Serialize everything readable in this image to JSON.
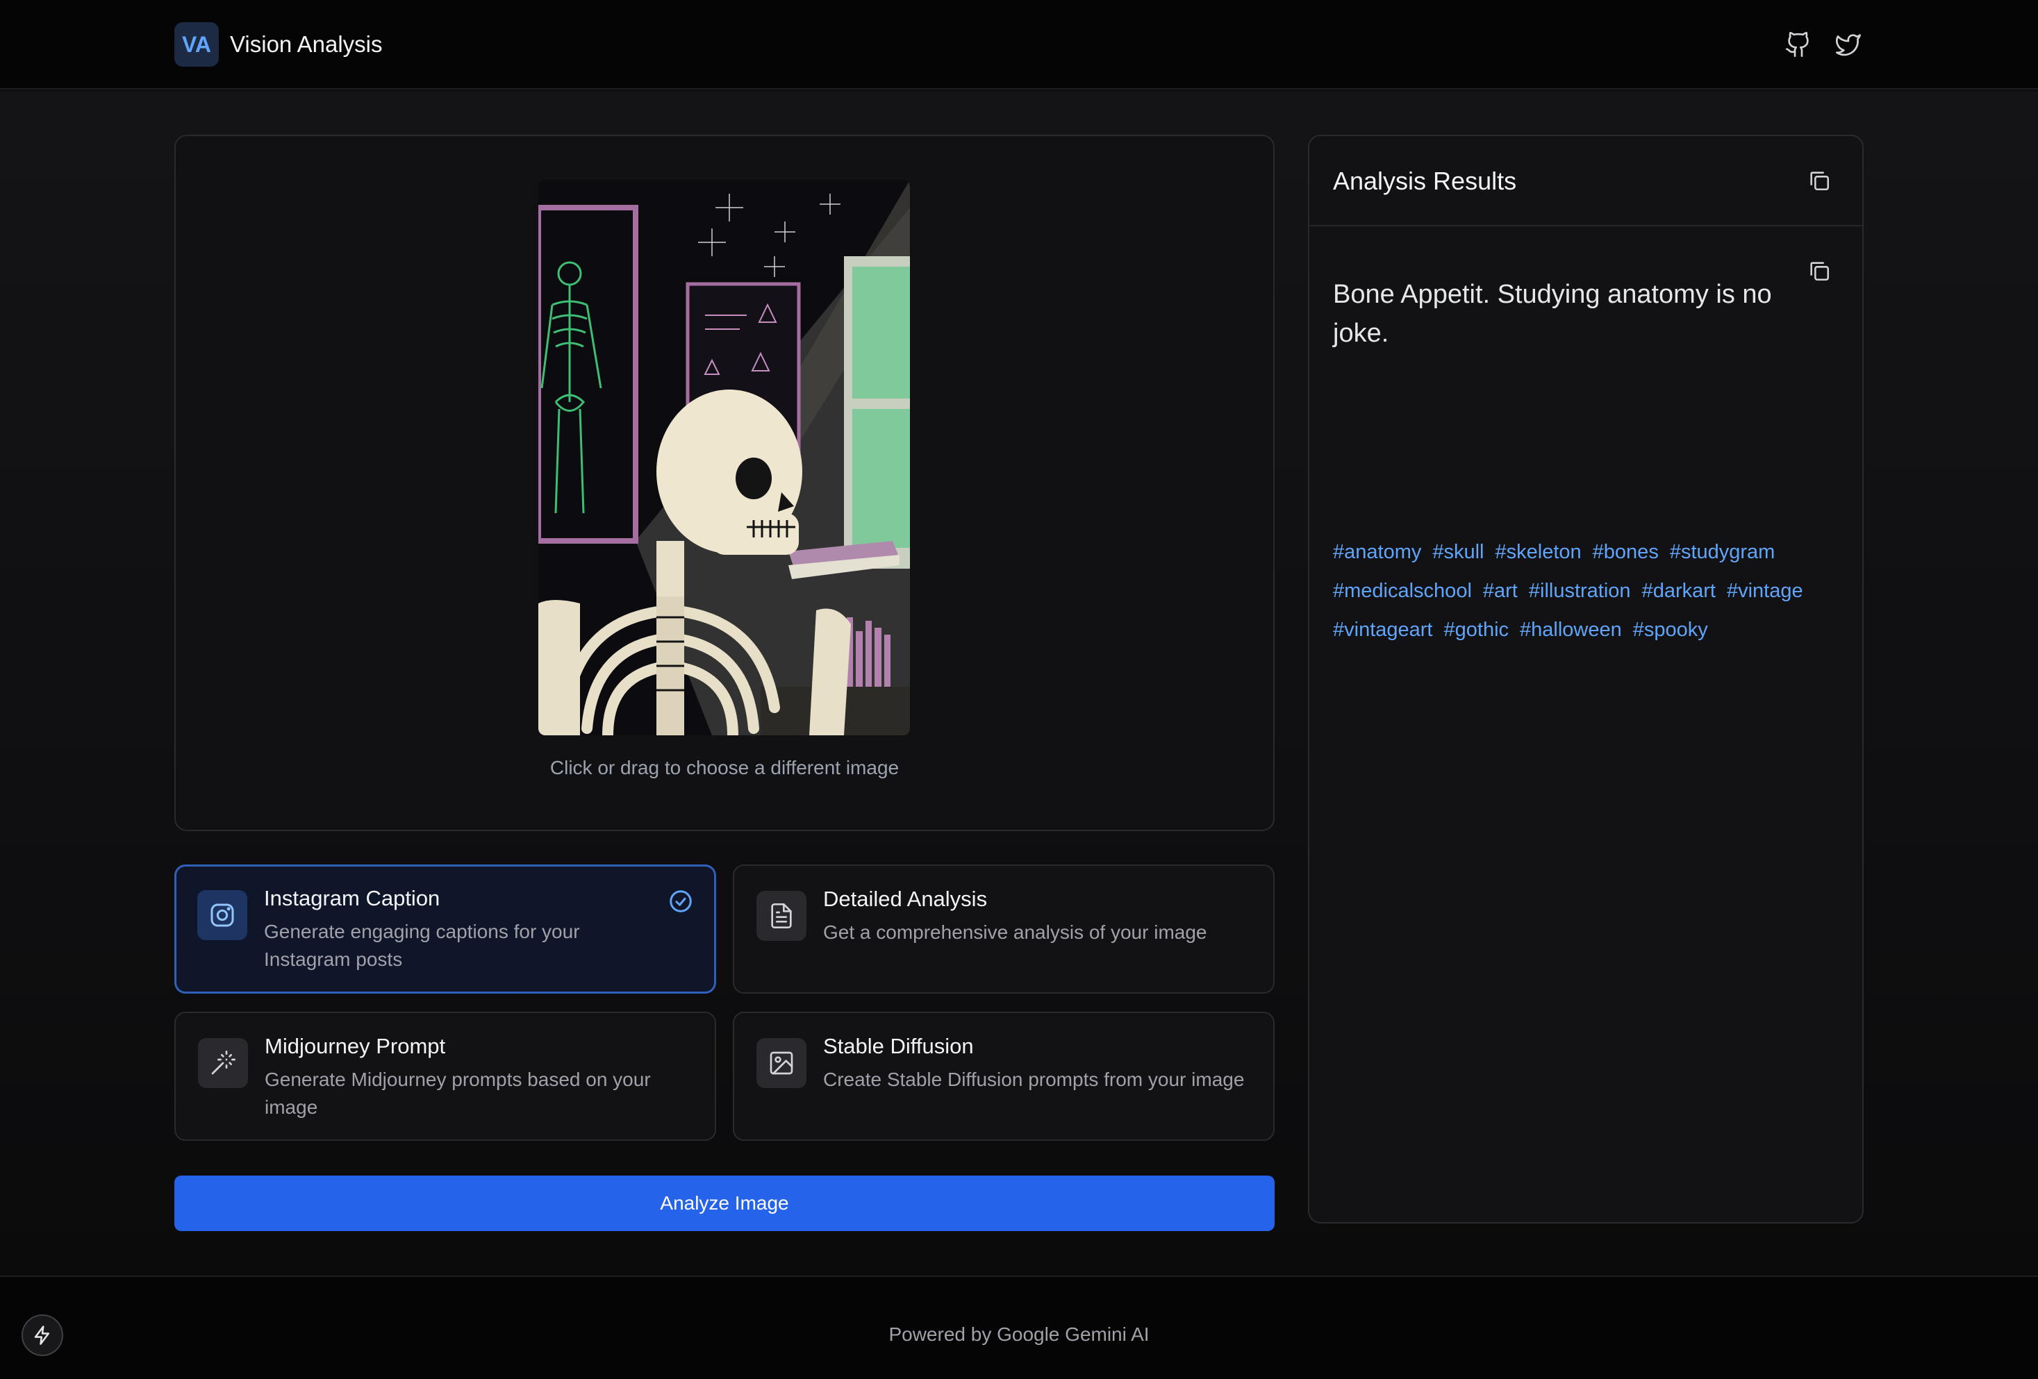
{
  "header": {
    "logo": "VA",
    "title": "Vision Analysis",
    "icons": [
      "github-icon",
      "twitter-icon"
    ]
  },
  "upload": {
    "hint": "Click or drag to choose a different image"
  },
  "modes": [
    {
      "title": "Instagram Caption",
      "description": "Generate engaging captions for your Instagram posts",
      "icon": "instagram-icon",
      "selected": true
    },
    {
      "title": "Detailed Analysis",
      "description": "Get a comprehensive analysis of your image",
      "icon": "document-icon",
      "selected": false
    },
    {
      "title": "Midjourney Prompt",
      "description": "Generate Midjourney prompts based on your image",
      "icon": "magic-wand-icon",
      "selected": false
    },
    {
      "title": "Stable Diffusion",
      "description": "Create Stable Diffusion prompts from your image",
      "icon": "image-icon",
      "selected": false
    }
  ],
  "analyze_button": "Analyze Image",
  "results": {
    "title": "Analysis Results",
    "caption": "Bone Appetit. Studying anatomy is no joke.",
    "hashtags": [
      "#anatomy",
      "#skull",
      "#skeleton",
      "#bones",
      "#studygram",
      "#medicalschool",
      "#art",
      "#illustration",
      "#darkart",
      "#vintage",
      "#vintageart",
      "#gothic",
      "#halloween",
      "#spooky"
    ]
  },
  "footer": {
    "text": "Powered by Google Gemini AI"
  },
  "colors": {
    "accent": "#2563eb",
    "tag": "#60a5fa",
    "background": "#0b0b0c"
  }
}
